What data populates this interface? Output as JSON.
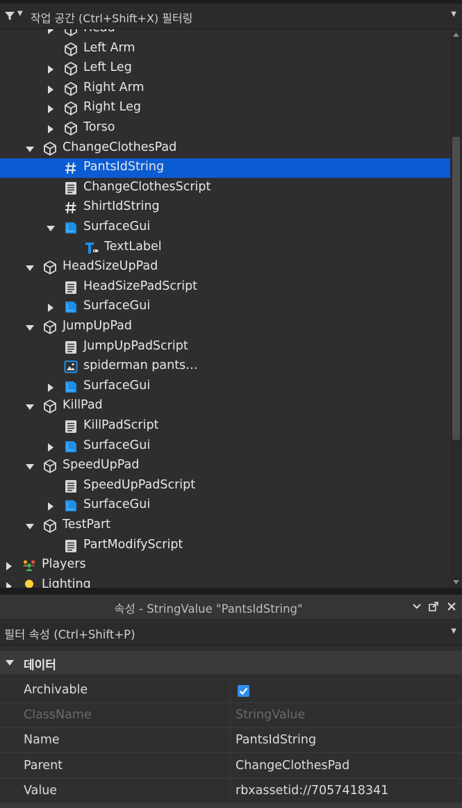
{
  "explorer": {
    "filter_text": "작업 공간 (Ctrl+Shift+X) 필터링",
    "items": [
      {
        "label": "Head",
        "indent": 3,
        "arrow": "right",
        "icon": "part-icon"
      },
      {
        "label": "Left Arm",
        "indent": 3,
        "arrow": "none",
        "icon": "part-icon"
      },
      {
        "label": "Left Leg",
        "indent": 3,
        "arrow": "right",
        "icon": "part-icon"
      },
      {
        "label": "Right Arm",
        "indent": 3,
        "arrow": "right",
        "icon": "part-icon"
      },
      {
        "label": "Right Leg",
        "indent": 3,
        "arrow": "right",
        "icon": "part-icon"
      },
      {
        "label": "Torso",
        "indent": 3,
        "arrow": "right",
        "icon": "part-icon"
      },
      {
        "label": "ChangeClothesPad",
        "indent": 2,
        "arrow": "down",
        "icon": "part-icon"
      },
      {
        "label": "PantsIdString",
        "indent": 3,
        "arrow": "none",
        "icon": "string-value-icon",
        "selected": true
      },
      {
        "label": "ChangeClothesScript",
        "indent": 3,
        "arrow": "none",
        "icon": "script-icon"
      },
      {
        "label": "ShirtIdString",
        "indent": 3,
        "arrow": "none",
        "icon": "string-value-icon"
      },
      {
        "label": "SurfaceGui",
        "indent": 3,
        "arrow": "down",
        "icon": "surface-gui-icon"
      },
      {
        "label": "TextLabel",
        "indent": 4,
        "arrow": "none",
        "icon": "text-label-icon"
      },
      {
        "label": "HeadSizeUpPad",
        "indent": 2,
        "arrow": "down",
        "icon": "part-icon"
      },
      {
        "label": "HeadSizePadScript",
        "indent": 3,
        "arrow": "none",
        "icon": "script-icon"
      },
      {
        "label": "SurfaceGui",
        "indent": 3,
        "arrow": "right",
        "icon": "surface-gui-icon"
      },
      {
        "label": "JumpUpPad",
        "indent": 2,
        "arrow": "down",
        "icon": "part-icon"
      },
      {
        "label": "JumpUpPadScript",
        "indent": 3,
        "arrow": "none",
        "icon": "script-icon"
      },
      {
        "label": "spiderman pants…",
        "indent": 3,
        "arrow": "none",
        "icon": "decal-icon"
      },
      {
        "label": "SurfaceGui",
        "indent": 3,
        "arrow": "right",
        "icon": "surface-gui-icon"
      },
      {
        "label": "KillPad",
        "indent": 2,
        "arrow": "down",
        "icon": "part-icon"
      },
      {
        "label": "KillPadScript",
        "indent": 3,
        "arrow": "none",
        "icon": "script-icon"
      },
      {
        "label": "SurfaceGui",
        "indent": 3,
        "arrow": "right",
        "icon": "surface-gui-icon"
      },
      {
        "label": "SpeedUpPad",
        "indent": 2,
        "arrow": "down",
        "icon": "part-icon"
      },
      {
        "label": "SpeedUpPadScript",
        "indent": 3,
        "arrow": "none",
        "icon": "script-icon"
      },
      {
        "label": "SurfaceGui",
        "indent": 3,
        "arrow": "right",
        "icon": "surface-gui-icon"
      },
      {
        "label": "TestPart",
        "indent": 2,
        "arrow": "down",
        "icon": "part-icon"
      },
      {
        "label": "PartModifyScript",
        "indent": 3,
        "arrow": "none",
        "icon": "script-icon"
      },
      {
        "label": "Players",
        "indent": 1,
        "arrow": "right",
        "icon": "players-icon"
      },
      {
        "label": "Lighting",
        "indent": 1,
        "arrow": "right",
        "icon": "lighting-icon"
      }
    ]
  },
  "properties": {
    "title": "속성 - StringValue \"PantsIdString\"",
    "filter_text": "필터 속성 (Ctrl+Shift+P)",
    "section": "데이터",
    "rows": [
      {
        "name": "Archivable",
        "value": "",
        "checkbox": true,
        "disabled": false
      },
      {
        "name": "ClassName",
        "value": "StringValue",
        "checkbox": false,
        "disabled": true
      },
      {
        "name": "Name",
        "value": "PantsIdString",
        "checkbox": false,
        "disabled": false
      },
      {
        "name": "Parent",
        "value": "ChangeClothesPad",
        "checkbox": false,
        "disabled": false
      },
      {
        "name": "Value",
        "value": "rbxassetid://7057418341",
        "checkbox": false,
        "disabled": false
      }
    ]
  },
  "colors": {
    "selection": "#0b5bd3",
    "accent_blue": "#2f8ef0",
    "background": "#2e2e2e"
  }
}
